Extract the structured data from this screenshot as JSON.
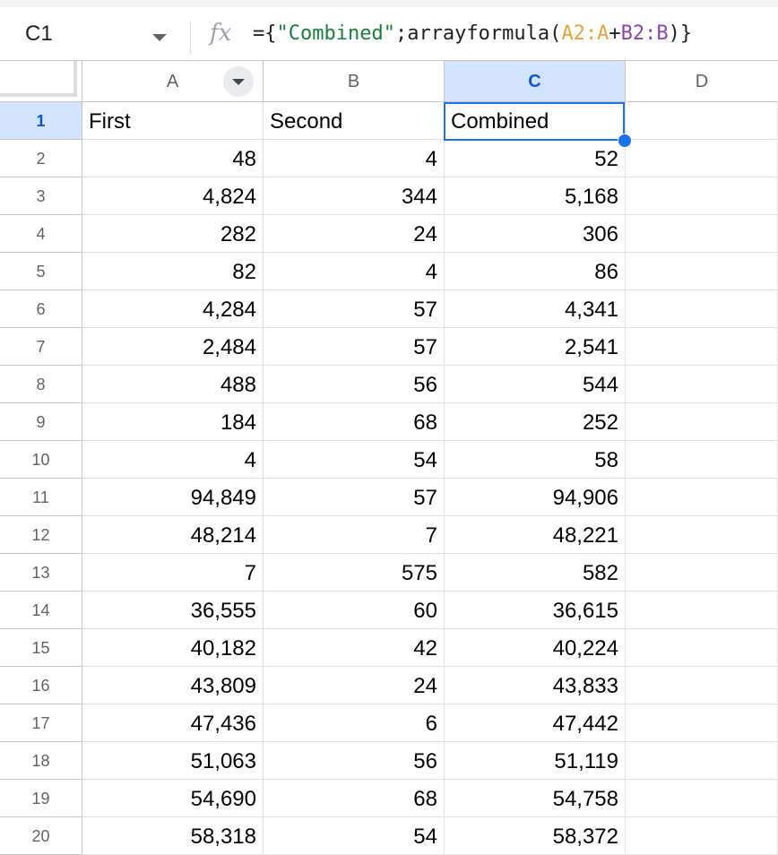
{
  "formula_bar": {
    "name_box": "C1",
    "fx_symbol": "fx",
    "formula_parts": [
      "={",
      "\"Combined\"",
      ";arrayformula(",
      "A2:A",
      "+",
      "B2:B",
      ")}"
    ]
  },
  "columns": [
    "A",
    "B",
    "C",
    "D"
  ],
  "header_row": {
    "row": "1",
    "A": "First",
    "B": "Second",
    "C": "Combined"
  },
  "rows": [
    {
      "row": "2",
      "A": "48",
      "B": "4",
      "C": "52"
    },
    {
      "row": "3",
      "A": "4,824",
      "B": "344",
      "C": "5,168"
    },
    {
      "row": "4",
      "A": "282",
      "B": "24",
      "C": "306"
    },
    {
      "row": "5",
      "A": "82",
      "B": "4",
      "C": "86"
    },
    {
      "row": "6",
      "A": "4,284",
      "B": "57",
      "C": "4,341"
    },
    {
      "row": "7",
      "A": "2,484",
      "B": "57",
      "C": "2,541"
    },
    {
      "row": "8",
      "A": "488",
      "B": "56",
      "C": "544"
    },
    {
      "row": "9",
      "A": "184",
      "B": "68",
      "C": "252"
    },
    {
      "row": "10",
      "A": "4",
      "B": "54",
      "C": "58"
    },
    {
      "row": "11",
      "A": "94,849",
      "B": "57",
      "C": "94,906"
    },
    {
      "row": "12",
      "A": "48,214",
      "B": "7",
      "C": "48,221"
    },
    {
      "row": "13",
      "A": "7",
      "B": "575",
      "C": "582"
    },
    {
      "row": "14",
      "A": "36,555",
      "B": "60",
      "C": "36,615"
    },
    {
      "row": "15",
      "A": "40,182",
      "B": "42",
      "C": "40,224"
    },
    {
      "row": "16",
      "A": "43,809",
      "B": "24",
      "C": "43,833"
    },
    {
      "row": "17",
      "A": "47,436",
      "B": "6",
      "C": "47,442"
    },
    {
      "row": "18",
      "A": "51,063",
      "B": "56",
      "C": "51,119"
    },
    {
      "row": "19",
      "A": "54,690",
      "B": "68",
      "C": "54,758"
    },
    {
      "row": "20",
      "A": "58,318",
      "B": "54",
      "C": "58,372"
    }
  ],
  "colors": {
    "selection": "#1a73e8",
    "header_selected_bg": "#d3e3fd"
  }
}
